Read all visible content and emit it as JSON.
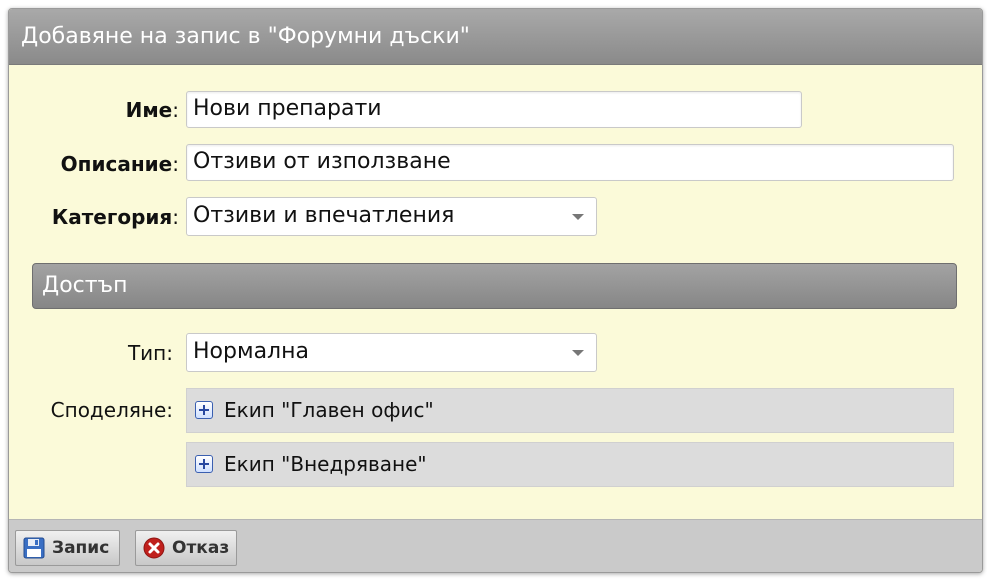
{
  "dialog": {
    "title": "Добавяне на запис в \"Форумни дъски\""
  },
  "form": {
    "name_label": "Име",
    "name_value": "Нови препарати",
    "description_label": "Описание",
    "description_value": "Отзиви от използване",
    "category_label": "Категория",
    "category_value": "Отзиви и впечатления",
    "colon": ":"
  },
  "access": {
    "section_title": "Достъп",
    "type_label": "Тип:",
    "type_value": "Нормална",
    "share_label": "Споделяне:",
    "teams": [
      {
        "label": "Екип \"Главен офис\""
      },
      {
        "label": "Екип \"Внедряване\""
      }
    ]
  },
  "footer": {
    "save_label": "Запис",
    "cancel_label": "Отказ"
  },
  "colors": {
    "panel_bg": "#fbfad9",
    "header_bg": "#9a9a9a",
    "save_icon": "#3a6fc4",
    "cancel_icon": "#c0201c"
  },
  "icons": {
    "save": "floppy-disk-icon",
    "cancel": "close-circle-icon",
    "expand": "plus-square-icon",
    "dropdown": "chevron-down-icon"
  }
}
